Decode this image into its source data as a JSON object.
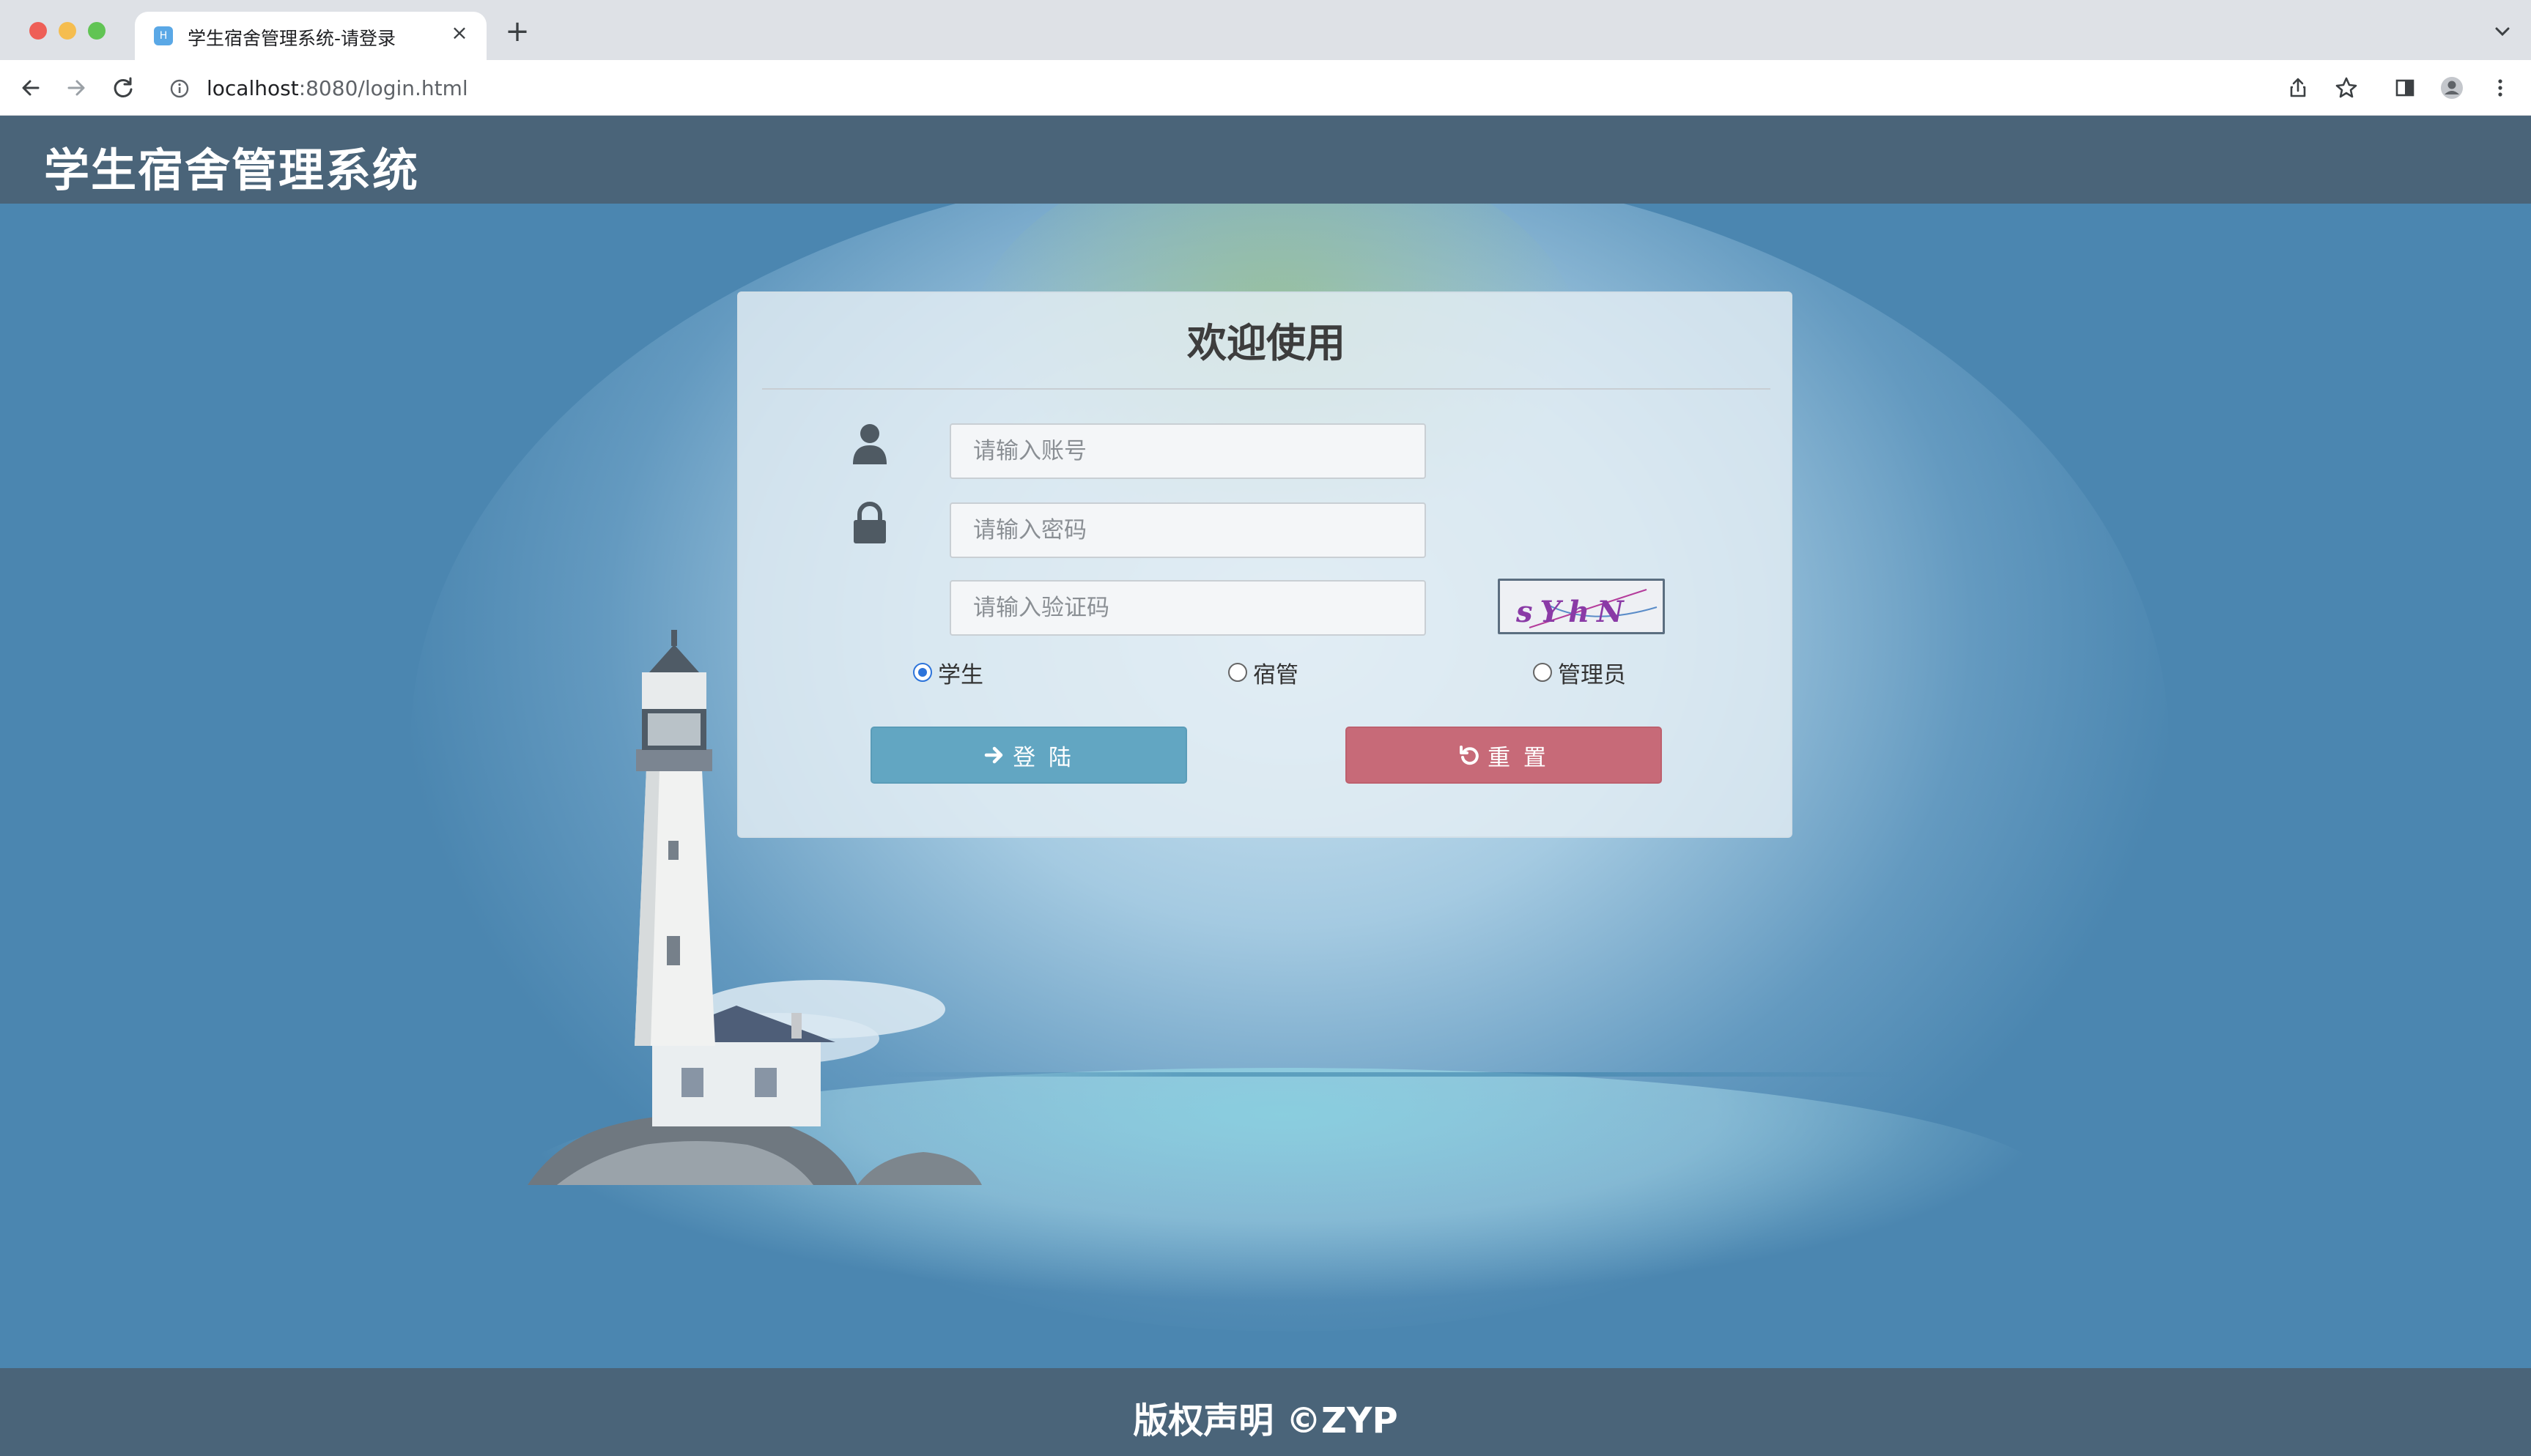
{
  "browser": {
    "tab_title": "学生宿舍管理系统-请登录",
    "tab_favicon_letter": "H",
    "tab_close": "×",
    "new_tab": "+",
    "url_host": "localhost",
    "url_path": ":8080/login.html"
  },
  "header": {
    "title": "学生宿舍管理系统"
  },
  "login": {
    "title": "欢迎使用",
    "username_placeholder": "请输入账号",
    "password_placeholder": "请输入密码",
    "captcha_placeholder": "请输入验证码",
    "captcha_text": "sYhN",
    "roles": [
      {
        "label": "学生",
        "selected": true
      },
      {
        "label": "宿管",
        "selected": false
      },
      {
        "label": "管理员",
        "selected": false
      }
    ],
    "login_button": "登 陆",
    "reset_button": "重 置"
  },
  "footer": {
    "copyright": "版权声明 ©ZYP"
  },
  "colors": {
    "header_bg": "#4a6479",
    "page_bg": "#4b86b0",
    "login_button": "#62a6c2",
    "reset_button": "#c76a78",
    "radio_selected": "#2d74da"
  },
  "icons": {
    "user": "user-icon",
    "password": "lock-icon",
    "login": "arrow-right-icon",
    "reset": "undo-icon"
  }
}
